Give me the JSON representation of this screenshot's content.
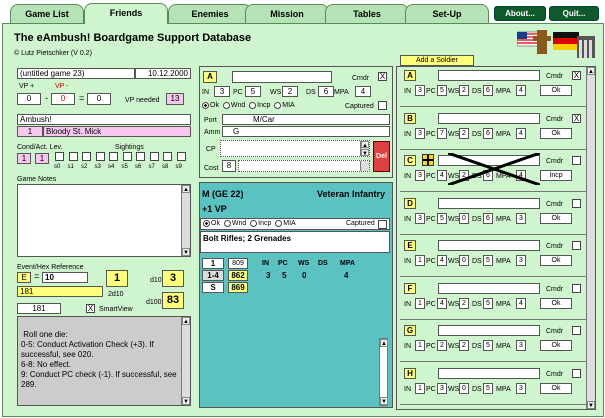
{
  "tabs": [
    "Game List",
    "Friends",
    "Enemies",
    "Mission",
    "Tables",
    "Set-Up"
  ],
  "dark_buttons": [
    "About...",
    "Quit..."
  ],
  "app_title": "The eAmbush! Boardgame Support Database",
  "copyright": "© Lutz Pietschker (V 0.2)",
  "add_soldier": "Add a Soldier",
  "game": {
    "name": "(untitled game 23)",
    "date": "10.12.2000",
    "vp_plus_label": "VP +",
    "vp_minus_label": "VP -",
    "vp_plus": "0",
    "vp_minus": "0",
    "minus_sign": "-",
    "equals_sign": "=",
    "vp_total": "0",
    "vp_needed_label": "VP needed",
    "vp_needed": "13",
    "module": "Ambush!",
    "mission_num": "1",
    "mission_name": "Bloody St. Mick",
    "cond_label": "Cond/Act. Lev.",
    "cond": "1",
    "act": "1",
    "sightings_label": "Sightings",
    "sightings": [
      "s0",
      "s1",
      "s2",
      "s3",
      "s4",
      "s5",
      "s6",
      "s7",
      "s8",
      "s9"
    ],
    "notes_label": "Game Notes",
    "event_label": "Event/Hex Reference",
    "event_type": "E",
    "event_num": "10",
    "event_val": "1",
    "d10_label": "d10",
    "d10": "3",
    "two_d10_label": "2d10",
    "extra": "181",
    "d100_label": "d100",
    "d100": "83",
    "smartview_val": "181",
    "smartview_label": "SmartView",
    "smartview_checked": "X",
    "event_text": "Roll one die:\n0-5: Conduct Activation Check (+3). If successful, see 020.\n6-8: No effect.\n9: Conduct PC check (-1). If successful, see 289."
  },
  "detail": {
    "letter": "A",
    "cmdr_label": "Cmdr",
    "cmdr_checked": "X",
    "stats": [
      {
        "k": "IN",
        "v": "3"
      },
      {
        "k": "PC",
        "v": "5"
      },
      {
        "k": "WS",
        "v": "2"
      },
      {
        "k": "DS",
        "v": "6"
      },
      {
        "k": "MPA",
        "v": "4"
      }
    ],
    "status_options": [
      "Ok",
      "Wnd",
      "Incp",
      "MIA"
    ],
    "captured_label": "Captured",
    "port_label": "Port",
    "port_value": "M/Car",
    "ammo_label": "Amm",
    "ammo_value": "G",
    "cp_label": "CP",
    "cost_label": "Cost",
    "cost_value": "8",
    "del_label": "Del"
  },
  "card": {
    "title": "M (GE 22)",
    "type": "Veteran Infantry",
    "vp": "+1 VP",
    "status_options": [
      "Ok",
      "Wnd",
      "Incp",
      "MIA"
    ],
    "captured_label": "Captured",
    "weapons": "Bolt Rifles; 2 Grenades",
    "row1_a": "1",
    "row1_b": "809",
    "row2_a": "1-4",
    "row2_b": "862",
    "row3_a": "S",
    "row3_b": "869",
    "stat_heads": [
      "IN",
      "PC",
      "WS",
      "DS",
      "MPA"
    ],
    "stat_vals": [
      "3",
      "5",
      "0",
      "",
      "4"
    ]
  },
  "units": [
    {
      "letter": "A",
      "cmdr_checked": "X",
      "IN": "3",
      "PC": "5",
      "WS": "2",
      "DS": "6",
      "MPA": "4",
      "status": "Ok",
      "marker": false,
      "crossed": false
    },
    {
      "letter": "B",
      "cmdr_checked": "X",
      "IN": "3",
      "PC": "7",
      "WS": "2",
      "DS": "6",
      "MPA": "4",
      "status": "Ok",
      "marker": false,
      "crossed": false
    },
    {
      "letter": "C",
      "cmdr_checked": "",
      "IN": "3",
      "PC": "4",
      "WS": "2",
      "DS": "6",
      "MPA": "4",
      "status": "Incp",
      "marker": true,
      "crossed": true
    },
    {
      "letter": "D",
      "cmdr_checked": "",
      "IN": "3",
      "PC": "5",
      "WS": "0",
      "DS": "6",
      "MPA": "3",
      "status": "Ok",
      "marker": false,
      "crossed": false
    },
    {
      "letter": "E",
      "cmdr_checked": "",
      "IN": "1",
      "PC": "4",
      "WS": "0",
      "DS": "5",
      "MPA": "3",
      "status": "Ok",
      "marker": false,
      "crossed": false
    },
    {
      "letter": "F",
      "cmdr_checked": "",
      "IN": "1",
      "PC": "4",
      "WS": "2",
      "DS": "5",
      "MPA": "4",
      "status": "Ok",
      "marker": false,
      "crossed": false
    },
    {
      "letter": "G",
      "cmdr_checked": "",
      "IN": "1",
      "PC": "2",
      "WS": "2",
      "DS": "5",
      "MPA": "3",
      "status": "Ok",
      "marker": false,
      "crossed": false
    },
    {
      "letter": "H",
      "cmdr_checked": "",
      "IN": "1",
      "PC": "3",
      "WS": "0",
      "DS": "5",
      "MPA": "3",
      "status": "Ok",
      "marker": false,
      "crossed": false
    }
  ],
  "unit_labels": {
    "cmdr": "Cmdr",
    "IN": "IN",
    "PC": "PC",
    "WS": "WS",
    "DS": "DS",
    "MPA": "MPA"
  },
  "colors": {
    "bg_green": "#cff5cf",
    "card_teal": "#5bc2c2",
    "dark_green": "#0f5a2a",
    "pink": "#f7c7ef",
    "yellow": "#ffff7a"
  }
}
